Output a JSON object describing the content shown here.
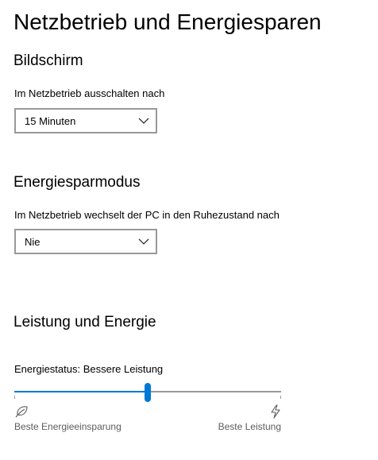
{
  "page": {
    "title": "Netzbetrieb und Energiesparen"
  },
  "screen": {
    "section_title": "Bildschirm",
    "label": "Im Netzbetrieb ausschalten nach",
    "dropdown_value": "15 Minuten"
  },
  "sleep": {
    "section_title": "Energiesparmodus",
    "label": "Im Netzbetrieb wechselt der PC in den Ruhezustand nach",
    "dropdown_value": "Nie"
  },
  "performance": {
    "section_title": "Leistung und Energie",
    "status_label": "Energiestatus: Bessere Leistung",
    "slider": {
      "value_fraction": 0.5,
      "min_label": "Beste Energieeinsparung",
      "max_label": "Beste Leistung",
      "min_icon": "leaf-icon",
      "max_icon": "lightning-bolt-icon"
    }
  },
  "colors": {
    "accent": "#0078d7",
    "border": "#999999",
    "secondary_text": "#5c5c5c"
  }
}
